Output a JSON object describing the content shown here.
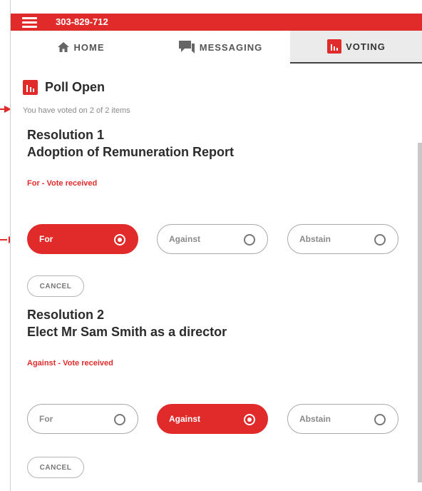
{
  "header": {
    "phone": "303-829-712"
  },
  "tabs": [
    {
      "label": "HOME"
    },
    {
      "label": "MESSAGING"
    },
    {
      "label": "VOTING"
    }
  ],
  "poll": {
    "title": "Poll Open",
    "progress_text": "You have voted on 2 of 2 items"
  },
  "resolutions": [
    {
      "number": "Resolution 1",
      "title": "Adoption of Remuneration Report",
      "status": "For - Vote received",
      "options": [
        "For",
        "Against",
        "Abstain"
      ],
      "selected": "For",
      "cancel_label": "CANCEL"
    },
    {
      "number": "Resolution 2",
      "title": "Elect Mr Sam Smith as a director",
      "status": "Against - Vote received",
      "options": [
        "For",
        "Against",
        "Abstain"
      ],
      "selected": "Against",
      "cancel_label": "CANCEL"
    }
  ],
  "colors": {
    "accent": "#e12b2b",
    "text": "#2b2b2b",
    "muted": "#8a8a8a"
  },
  "icons": {
    "menu": "hamburger-icon",
    "home": "home-icon",
    "messaging": "chat-icon",
    "voting": "bar-chart-icon"
  }
}
